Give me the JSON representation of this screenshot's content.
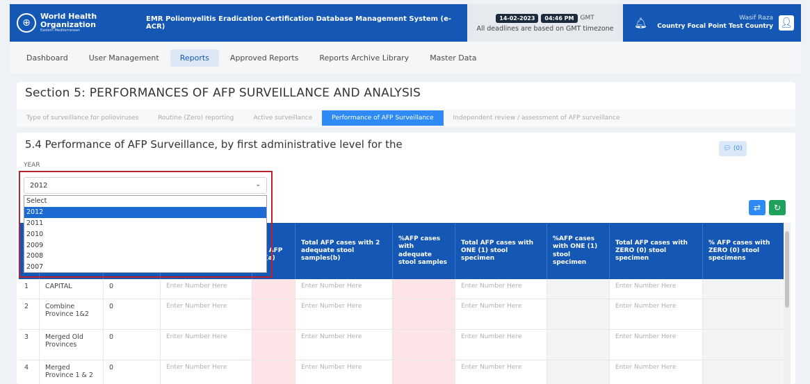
{
  "header": {
    "logo_line1": "World Health",
    "logo_line2": "Organization",
    "logo_line3": "Eastern Mediterranean",
    "app_title": "EMR Poliomyelitis Eradication Certification Database Management System (e-ACR)",
    "date": "14-02-2023",
    "time": "04:46 PM",
    "timezone": "GMT",
    "deadline_note": "All deadlines are based on GMT timezone",
    "user_name": "Wasif Raza",
    "user_role": "Country Focal Point Test Country"
  },
  "nav": {
    "items": [
      "Dashboard",
      "User Management",
      "Reports",
      "Approved Reports",
      "Reports Archive Library",
      "Master Data"
    ],
    "active": "Reports"
  },
  "section": {
    "title": "Section 5: PERFORMANCES OF AFP SURVEILLANCE AND ANALYSIS",
    "tabs": [
      "Type of surveillance for polioviruses",
      "Routine (Zero) reporting",
      "Active surveillance",
      "Performance of AFP Surveillance",
      "Independent review / assessment of AFP surveillance"
    ],
    "active_tab": "Performance of AFP Surveillance"
  },
  "main": {
    "subtitle": "5.4 Performance of AFP Surveillance, by first administrative level for the",
    "comment_count": "(0)",
    "year_label": "YEAR",
    "year_selected": "2012",
    "year_options": [
      "Select",
      "2012",
      "2011",
      "2010",
      "2009",
      "2008",
      "2007"
    ]
  },
  "table": {
    "headers": {
      "rate_a": "on-\nolio AFP\nate(a)",
      "adequate_b": "Total AFP cases with 2 adequate stool samples(b)",
      "pct_adequate": "%AFP cases with adequate stool samples",
      "one_stool": "Total AFP cases with ONE (1) stool specimen",
      "pct_one": "%AFP cases with ONE (1) stool specimen",
      "zero_stool": "Total AFP cases with ZERO (0) stool specimen",
      "pct_zero": "% AFP cases with ZERO (0) stool specimens"
    },
    "placeholder": "Enter Number Here",
    "rows": [
      {
        "num": "1",
        "name": "CAPITAL",
        "val": "0"
      },
      {
        "num": "2",
        "name": "Combine Province 1&2",
        "val": "0"
      },
      {
        "num": "3",
        "name": "Merged Old Provinces",
        "val": "0"
      },
      {
        "num": "4",
        "name": "Merged Province 1 & 2",
        "val": "0"
      }
    ]
  },
  "colors": {
    "brand_blue": "#1457b4",
    "active_tab": "#2e8bf5",
    "pink_cell": "#fde4e7",
    "highlight": "#b8232f"
  }
}
